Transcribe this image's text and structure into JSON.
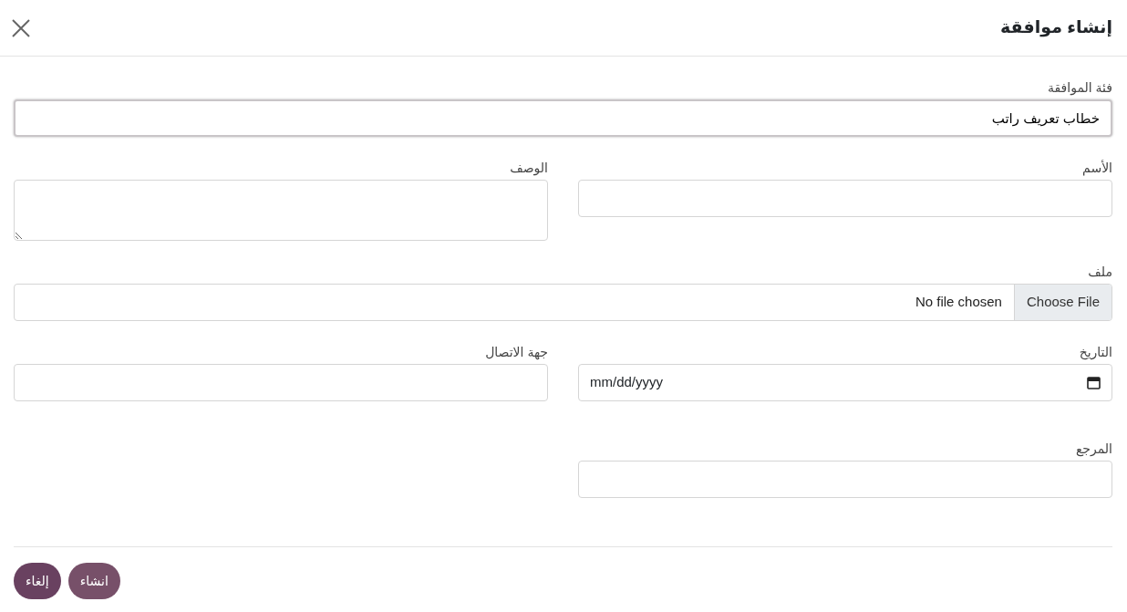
{
  "dialog": {
    "title": "إنشاء موافقة"
  },
  "rows": [
    [
      {
        "kind": "text",
        "label": "فئة الموافقة",
        "value": "خطاب تعريف راتب",
        "focused": true
      }
    ],
    [
      {
        "kind": "text",
        "label": "الأسم",
        "focused": false
      },
      {
        "kind": "textarea",
        "label": "الوصف",
        "focused": false
      }
    ],
    [
      {
        "kind": "file",
        "label": "ملف",
        "button": "Choose File",
        "status": "No file chosen"
      }
    ],
    [
      {
        "kind": "date",
        "label": "التاريخ",
        "placeholder": "mm/dd/yyyy"
      },
      {
        "kind": "text",
        "label": "جهة الاتصال",
        "focused": false
      }
    ],
    [
      {
        "kind": "text",
        "label": "المرجع",
        "focused": false
      }
    ]
  ],
  "buttons": [
    {
      "label": "انشاء"
    },
    {
      "label": "إلغاء"
    }
  ]
}
